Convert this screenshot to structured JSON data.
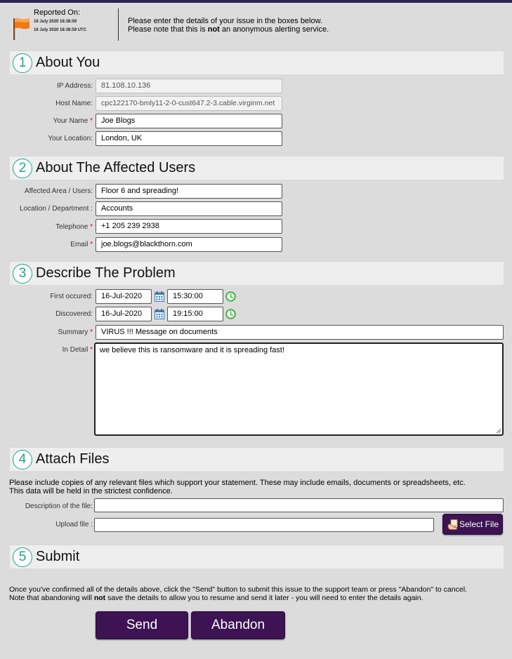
{
  "header": {
    "reported_label": "Reported On:",
    "reported_local": "16 July 2020 18:38:59",
    "reported_utc": "16 July 2020 18:38:59 UTC",
    "notice_line1": "Please enter the details of your issue in the boxes below.",
    "notice_line2_pre": "Please note that this is ",
    "notice_line2_bold": "not",
    "notice_line2_post": " an anonymous alerting service."
  },
  "sections": {
    "s1": {
      "num": "1",
      "title": "About You"
    },
    "s2": {
      "num": "2",
      "title": "About The Affected Users"
    },
    "s3": {
      "num": "3",
      "title": "Describe The Problem"
    },
    "s4": {
      "num": "4",
      "title": "Attach Files"
    },
    "s5": {
      "num": "5",
      "title": "Submit"
    }
  },
  "about_you": {
    "ip_label": "IP Address:",
    "ip_value": "81.108.10.136",
    "host_label": "Host Name:",
    "host_value": "cpc122170-bmly11-2-0-cust647.2-3.cable.virginm.net",
    "name_label": "Your Name",
    "name_value": "Joe Blogs",
    "location_label": "Your Location:",
    "location_value": "London, UK"
  },
  "affected": {
    "area_label": "Affected Area / Users:",
    "area_value": "Floor 6 and spreading!",
    "dept_label": "Location / Department :",
    "dept_value": "Accounts",
    "phone_label": "Telephone",
    "phone_value": "+1 205 239 2938",
    "email_label": "Email",
    "email_value": "joe.blogs@blackthorn.com"
  },
  "problem": {
    "first_label": "First occured:",
    "first_date": "16-Jul-2020",
    "first_time": "15:30:00",
    "disc_label": "Discovered:",
    "disc_date": "16-Jul-2020",
    "disc_time": "19:15:00",
    "summary_label": "Summary",
    "summary_value": "VIRUS !!! Message on documents",
    "detail_label": "In Detail",
    "detail_value": "we believe this is ransomware and it is spreading fast!"
  },
  "attach": {
    "intro_line1": "Please include copies of any relevant files which support your statement. These may include emails, documents or spreadsheets, etc.",
    "intro_line2": "This data will be held in the strictest confidence.",
    "desc_label": "Description of the file:",
    "desc_value": "",
    "upload_label": "Upload file :",
    "upload_value": "",
    "select_label": "Select File"
  },
  "submit": {
    "info_line1": "Once you've confirmed all of the details above, click the \"Send\" button to submit this issue to the support team or press \"Abandon\" to cancel.",
    "info_line2_pre": "Note that abandoning will ",
    "info_line2_bold": "not",
    "info_line2_post": " save the details to allow you to resume and send it later - you will need to enter the details again.",
    "send_label": "Send",
    "abandon_label": "Abandon"
  },
  "required_marker": "*",
  "colors": {
    "accent": "#1fa58a",
    "button": "#3d1353",
    "required": "#d0021b",
    "clock": "#3db53d"
  }
}
